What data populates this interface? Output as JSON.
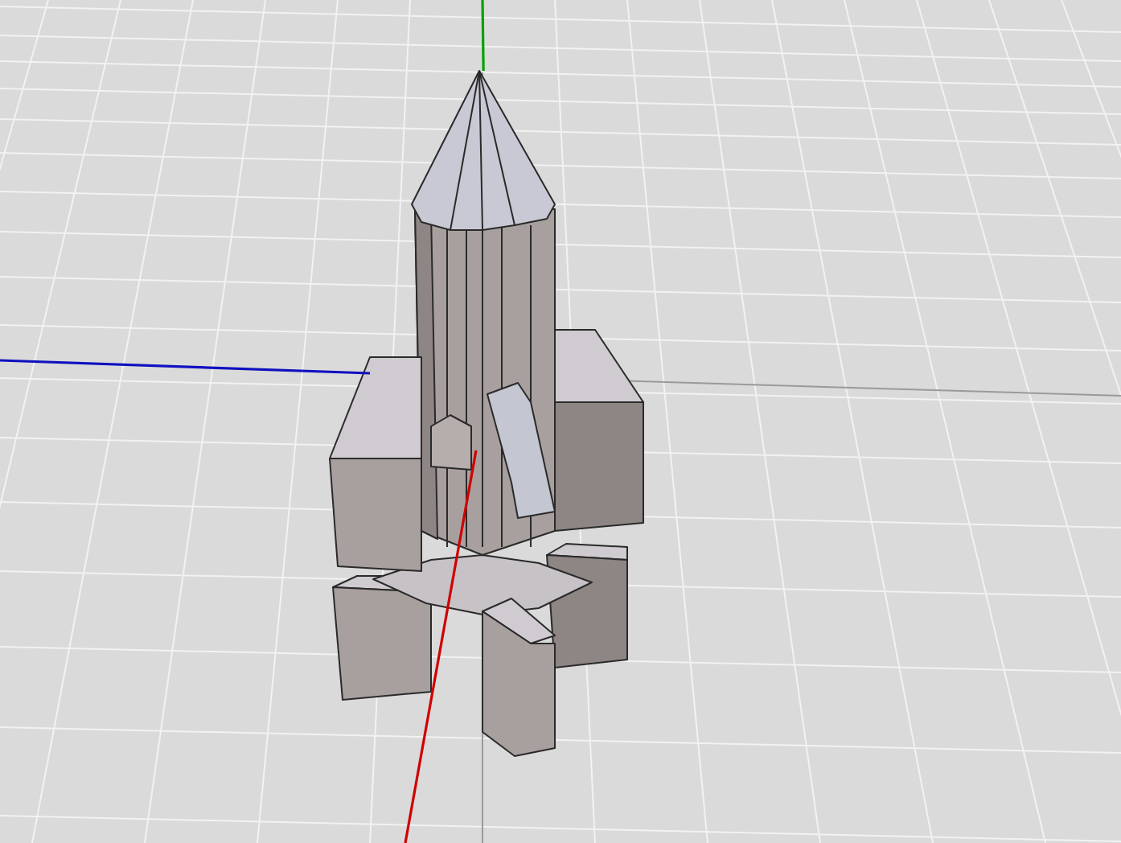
{
  "axes": [
    {
      "color": "#00a000"
    },
    {
      "color": "#1010c0"
    },
    {
      "color": "#d00000"
    }
  ]
}
